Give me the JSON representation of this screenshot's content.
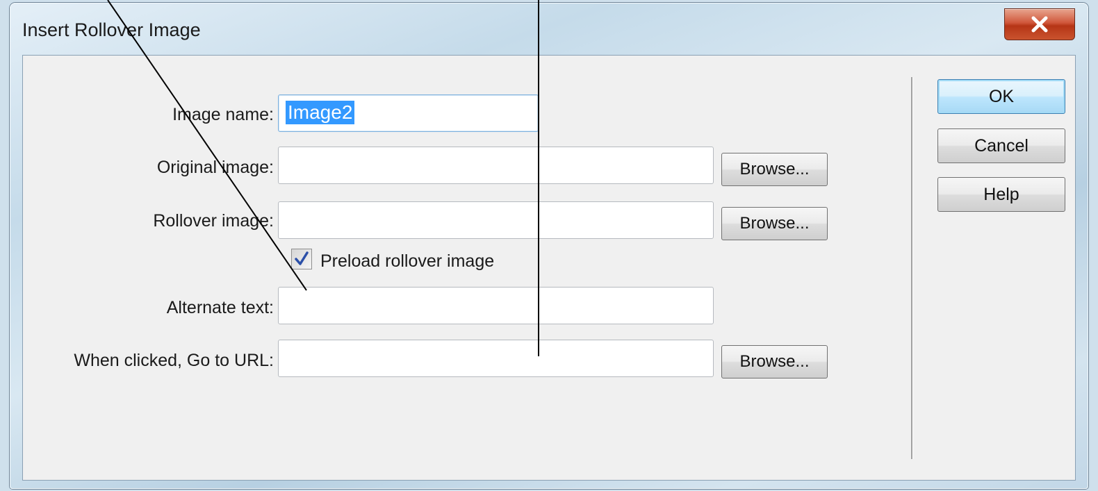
{
  "window": {
    "title": "Insert Rollover Image"
  },
  "form": {
    "image_name_label": "Image name:",
    "image_name_value": "Image2",
    "original_image_label": "Original image:",
    "original_image_value": "",
    "rollover_image_label": "Rollover image:",
    "rollover_image_value": "",
    "preload_label": "Preload rollover image",
    "preload_checked": true,
    "alternate_text_label": "Alternate text:",
    "alternate_text_value": "",
    "url_label": "When clicked, Go to URL:",
    "url_value": "",
    "browse_label": "Browse..."
  },
  "buttons": {
    "ok": "OK",
    "cancel": "Cancel",
    "help": "Help"
  },
  "icons": {
    "close": "close-icon",
    "check": "checkmark-icon"
  },
  "colors": {
    "selection": "#3399ff",
    "close_button": "#c9452a",
    "check_mark": "#2b4fa8"
  }
}
